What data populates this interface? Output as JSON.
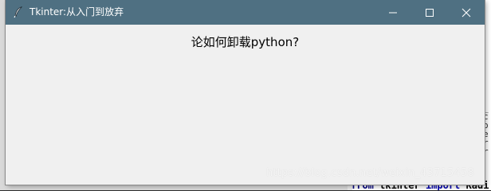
{
  "window": {
    "title": "Tkinter:从入门到放弃",
    "controls": {
      "minimize_icon": "minimize-icon",
      "maximize_icon": "maximize-icon",
      "close_icon": "close-icon"
    },
    "titlebar_color": "#4f7082",
    "client_color": "#f0f0f0"
  },
  "content": {
    "label": "论如何卸载python?"
  },
  "background": {
    "code_line": {
      "kw1": "from",
      "module": " tkinter ",
      "kw2": "import",
      "rest": " Radi"
    },
    "side_snippets": [
      "_",
      "c",
      "",
      "p",
      "e",
      "",
      "r",
      "",
      "r"
    ]
  },
  "watermark": "https://blog.csdn.net/weixin_43715458"
}
